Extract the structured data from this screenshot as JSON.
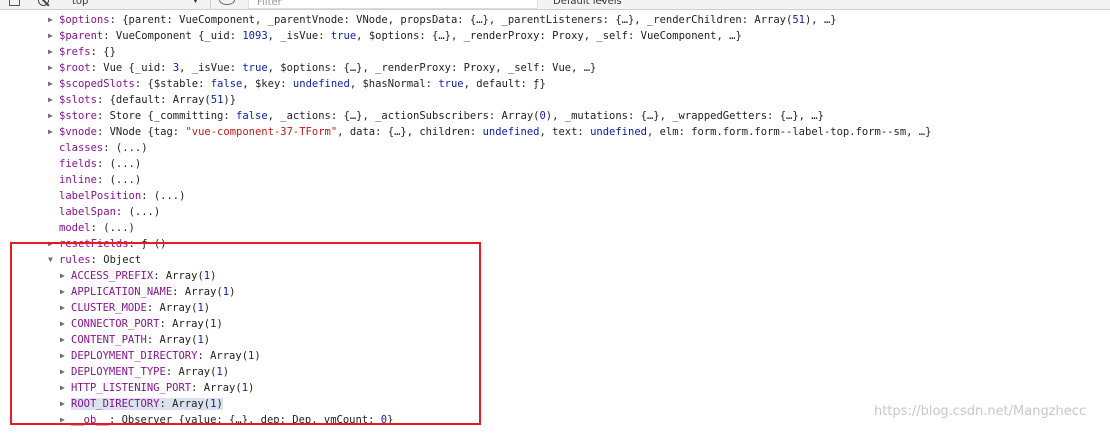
{
  "toolbar": {
    "context": "top",
    "context_arrow": "▼",
    "filter_placeholder": "Filter",
    "levels": "Default levels",
    "levels_arrow": "▾"
  },
  "rows": [
    {
      "expand": "collapsed",
      "key": "$options",
      "value": "{parent: VueComponent, _parentVnode: VNode, propsData: {…}, _parentListeners: {…}, _renderChildren: Array(51), …}"
    },
    {
      "expand": "collapsed",
      "key": "$parent",
      "value": "VueComponent {_uid: 1093, _isVue: true, $options: {…}, _renderProxy: Proxy, _self: VueComponent, …}"
    },
    {
      "expand": "collapsed",
      "key": "$refs",
      "value": "{}"
    },
    {
      "expand": "collapsed",
      "key": "$root",
      "value": "Vue {_uid: 3, _isVue: true, $options: {…}, _renderProxy: Proxy, _self: Vue, …}"
    },
    {
      "expand": "collapsed",
      "key": "$scopedSlots",
      "value": "{$stable: false, $key: undefined, $hasNormal: true, default: ƒ}"
    },
    {
      "expand": "collapsed",
      "key": "$slots",
      "value": "{default: Array(51)}"
    },
    {
      "expand": "collapsed",
      "key": "$store",
      "value": "Store {_committing: false, _actions: {…}, _actionSubscribers: Array(0), _mutations: {…}, _wrappedGetters: {…}, …}"
    },
    {
      "expand": "collapsed",
      "key": "$vnode",
      "value": "VNode {tag: \"vue-component-37-TForm\", data: {…}, children: undefined, text: undefined, elm: form.form.form--label-top.form--sm, …}"
    },
    {
      "expand": "none",
      "key": "classes",
      "value": "(...)"
    },
    {
      "expand": "none",
      "key": "fields",
      "value": "(...)"
    },
    {
      "expand": "none",
      "key": "inline",
      "value": "(...)"
    },
    {
      "expand": "none",
      "key": "labelPosition",
      "value": "(...)"
    },
    {
      "expand": "none",
      "key": "labelSpan",
      "value": "(...)"
    },
    {
      "expand": "none",
      "key": "model",
      "value": "(...)"
    },
    {
      "expand": "collapsed",
      "key": "resetFields",
      "value": "ƒ ()"
    },
    {
      "expand": "expanded",
      "key": "rules",
      "value": "Object"
    },
    {
      "expand": "collapsed",
      "key": "ACCESS_PREFIX",
      "value": "Array(1)"
    },
    {
      "expand": "collapsed",
      "key": "APPLICATION_NAME",
      "value": "Array(1)"
    },
    {
      "expand": "collapsed",
      "key": "CLUSTER_MODE",
      "value": "Array(1)"
    },
    {
      "expand": "collapsed",
      "key": "CONNECTOR_PORT",
      "value": "Array(1)"
    },
    {
      "expand": "collapsed",
      "key": "CONTENT_PATH",
      "value": "Array(1)"
    },
    {
      "expand": "collapsed",
      "key": "DEPLOYMENT_DIRECTORY",
      "value": "Array(1)"
    },
    {
      "expand": "collapsed",
      "key": "DEPLOYMENT_TYPE",
      "value": "Array(1)"
    },
    {
      "expand": "collapsed",
      "key": "HTTP_LISTENING_PORT",
      "value": "Array(1)"
    },
    {
      "expand": "collapsed",
      "key": "ROOT_DIRECTORY",
      "value": "Array(1)",
      "selected": true
    },
    {
      "expand": "collapsed",
      "key": "__ob__",
      "value": "Observer {value: {…}, dep: Dep, vmCount: 0}"
    }
  ],
  "watermark": "https://blog.csdn.net/Mangzhecc",
  "colors": {
    "property": "#881391",
    "string": "#c41a16",
    "keyword": "#0d22aa",
    "highlight_box": "#e81b22",
    "selection": "#dae3ee"
  }
}
